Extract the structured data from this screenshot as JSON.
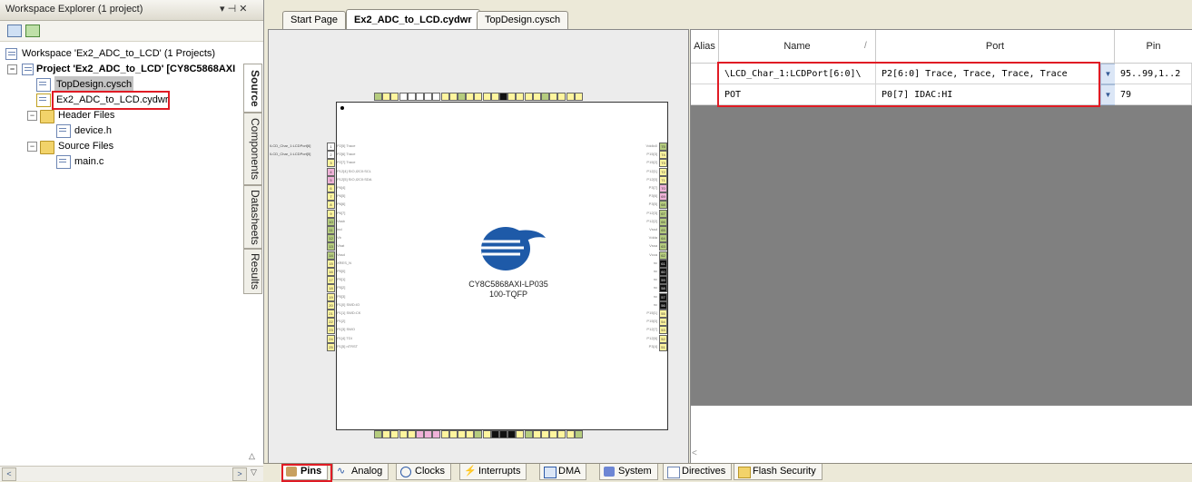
{
  "explorer": {
    "title": "Workspace Explorer (1 project)",
    "pin_controls": "▾ ⊣ ✕",
    "tree": [
      {
        "label": "Workspace 'Ex2_ADC_to_LCD' (1 Projects)",
        "kind": "workspace"
      },
      {
        "label": "Project 'Ex2_ADC_to_LCD' [CY8C5868AXI",
        "kind": "project"
      },
      {
        "label": "TopDesign.cysch",
        "kind": "schematic"
      },
      {
        "label": "Ex2_ADC_to_LCD.cydwr",
        "kind": "cydwr"
      },
      {
        "label": "Header Files",
        "kind": "folder"
      },
      {
        "label": "device.h",
        "kind": "file"
      },
      {
        "label": "Source Files",
        "kind": "folder"
      },
      {
        "label": "main.c",
        "kind": "file"
      }
    ],
    "side_tabs": [
      "Source",
      "Components",
      "Datasheets",
      "Results"
    ]
  },
  "doc_tabs": [
    "Start Page",
    "Ex2_ADC_to_LCD.cydwr",
    "TopDesign.cysch"
  ],
  "chip": {
    "part": "CY8C5868AXI-LP035",
    "package": "100-TQFP",
    "left_labels": [
      "\\LCD_Char_1:LCDPort[6]",
      "\\LCD_Char_1:LCDPort[5]"
    ],
    "left_pins": [
      "P2[5] Trace",
      "P2[6] Trace",
      "P2[7] Trace",
      "P12[4] SIO,I2C0:SCL",
      "P12[5] SIO,I2C0:SDA",
      "P6[4]",
      "P6[5]",
      "P6[6]",
      "P6[7]",
      "Vssb",
      "Ind",
      "Vb",
      "Vbat",
      "Vssd",
      "XRES_N",
      "P5[0]",
      "P5[1]",
      "P5[2]",
      "P5[3]",
      "P1[0] SWD:IO",
      "P1[1] SWD:CK",
      "P1[2]",
      "P1[3] SWO",
      "P1[4] TDI",
      "P1[5] nTRST"
    ],
    "right_pins": [
      "Vddio0",
      "P15[3]",
      "P15[2]",
      "P12[1]",
      "P12[0]",
      "P3[7]",
      "P3[6]",
      "P3[5]",
      "P12[3]",
      "P12[2]",
      "Vssd",
      "Vdda",
      "Vssa",
      "Vcca",
      "nc",
      "nc",
      "nc",
      "nc",
      "nc",
      "nc",
      "P15[1]",
      "P15[0]",
      "P12[7]",
      "P12[6]",
      "P3[4]"
    ]
  },
  "table": {
    "headers": [
      "Alias",
      "Name",
      "Port",
      "Pin"
    ],
    "rows": [
      {
        "alias": "",
        "name": "\\LCD_Char_1:LCDPort[6:0]\\",
        "port": "P2[6:0] Trace, Trace, Trace, Trace",
        "pin": "95..99,1..2"
      },
      {
        "alias": "",
        "name": "POT",
        "port": "P0[7] IDAC:HI",
        "pin": "79"
      }
    ]
  },
  "bottom_tabs": [
    "Pins",
    "Analog",
    "Clocks",
    "Interrupts",
    "DMA",
    "System",
    "Directives",
    "Flash Security"
  ],
  "colors": {
    "highlight": "#e01b24",
    "accent": "#2d5aa8"
  }
}
